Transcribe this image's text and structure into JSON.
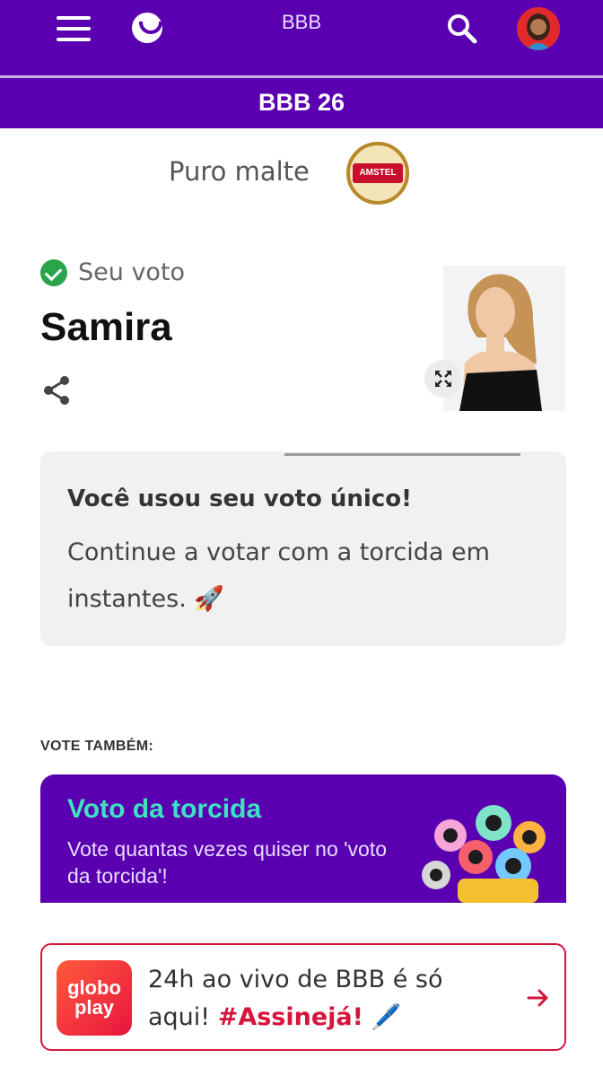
{
  "header": {
    "title": "BBB",
    "icons": {
      "menu": "hamburger-menu-icon",
      "logo": "smile-logo-icon",
      "search": "search-icon",
      "avatar": "user-avatar"
    }
  },
  "program": {
    "title": "BBB 26"
  },
  "sponsor": {
    "text": "Puro malte",
    "logo_text": "AMSTEL"
  },
  "vote": {
    "status_label": "Seu voto",
    "candidate_name": "Samira"
  },
  "info_card": {
    "title": "Você usou seu voto único!",
    "body": "Continue a votar com a torcida em instantes. 🚀"
  },
  "also": {
    "label": "VOTE TAMBÉM:",
    "title": "Voto da torcida",
    "description": "Vote quantas vezes quiser no 'voto da torcida'!"
  },
  "banner": {
    "logo_line1": "globo",
    "logo_line2": "play",
    "text_prefix": "24h ao vivo de BBB é só aqui! ",
    "hashtag": "#Assinejá!",
    "text_suffix": " 🖊️"
  },
  "colors": {
    "primary_purple": "#5a00b0",
    "accent_teal": "#3be3c3",
    "success_green": "#2aa54b",
    "globoplay_red": "#d4163c"
  }
}
